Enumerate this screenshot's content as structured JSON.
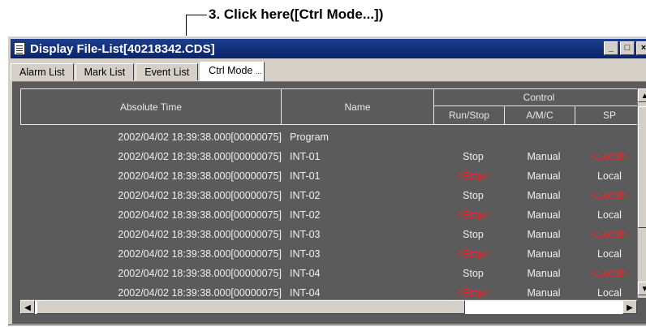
{
  "annotation": {
    "text": "3. Click here([Ctrl Mode...])"
  },
  "window": {
    "title": "Display File-List[40218342.CDS]",
    "buttons": {
      "minimize": "_",
      "maximize": "□",
      "close": "×"
    }
  },
  "tabs": [
    {
      "label": "Alarm List"
    },
    {
      "label": "Mark List"
    },
    {
      "label": "Event List"
    },
    {
      "label": "Ctrl Mode",
      "suffix": "..."
    }
  ],
  "table": {
    "headers": {
      "time": "Absolute Time",
      "name": "Name",
      "control": "Control",
      "runstop": "Run/Stop",
      "amc": "A/M/C",
      "sp": "SP"
    },
    "rows": [
      {
        "time": "2002/04/02 18:39:38.000[00000075]",
        "name": "Program",
        "runstop": "",
        "amc": "",
        "sp": ""
      },
      {
        "time": "2002/04/02 18:39:38.000[00000075]",
        "name": "INT-01",
        "runstop": "Stop",
        "amc": "Manual",
        "sp": "<Local>"
      },
      {
        "time": "2002/04/02 18:39:38.000[00000075]",
        "name": "INT-01",
        "runstop": "<Stop>",
        "amc": "Manual",
        "sp": "Local"
      },
      {
        "time": "2002/04/02 18:39:38.000[00000075]",
        "name": "INT-02",
        "runstop": "Stop",
        "amc": "Manual",
        "sp": "<Local>"
      },
      {
        "time": "2002/04/02 18:39:38.000[00000075]",
        "name": "INT-02",
        "runstop": "<Stop>",
        "amc": "Manual",
        "sp": "Local"
      },
      {
        "time": "2002/04/02 18:39:38.000[00000075]",
        "name": "INT-03",
        "runstop": "Stop",
        "amc": "Manual",
        "sp": "<Local>"
      },
      {
        "time": "2002/04/02 18:39:38.000[00000075]",
        "name": "INT-03",
        "runstop": "<Stop>",
        "amc": "Manual",
        "sp": "Local"
      },
      {
        "time": "2002/04/02 18:39:38.000[00000075]",
        "name": "INT-04",
        "runstop": "Stop",
        "amc": "Manual",
        "sp": "<Local>"
      },
      {
        "time": "2002/04/02 18:39:38.000[00000075]",
        "name": "INT-04",
        "runstop": "<Stop>",
        "amc": "Manual",
        "sp": "Local"
      }
    ]
  },
  "colors": {
    "highlight": "#ff2020",
    "panel": "#5b5b5b",
    "titlebar": "#0a246a"
  }
}
